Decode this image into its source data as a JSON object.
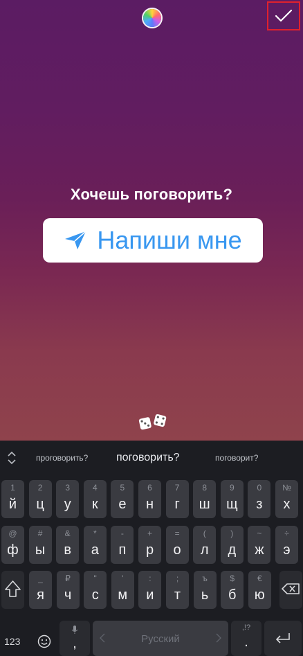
{
  "story": {
    "question": "Хочешь поговорить?",
    "sticker_label": "Напиши мне"
  },
  "icons": {
    "color_picker": "color-wheel-icon",
    "done": "checkmark-icon",
    "dice": "dice-icon",
    "sticker": "paper-plane-icon"
  },
  "keyboard": {
    "suggestions": [
      "проговорить?",
      "поговорить?",
      "поговорит?"
    ],
    "row1": [
      {
        "sec": "1",
        "pri": "й"
      },
      {
        "sec": "2",
        "pri": "ц"
      },
      {
        "sec": "3",
        "pri": "у"
      },
      {
        "sec": "4",
        "pri": "к"
      },
      {
        "sec": "5",
        "pri": "е"
      },
      {
        "sec": "6",
        "pri": "н"
      },
      {
        "sec": "7",
        "pri": "г"
      },
      {
        "sec": "8",
        "pri": "ш"
      },
      {
        "sec": "9",
        "pri": "щ"
      },
      {
        "sec": "0",
        "pri": "з"
      },
      {
        "sec": "№",
        "pri": "х"
      }
    ],
    "row2": [
      {
        "sec": "@",
        "pri": "ф"
      },
      {
        "sec": "#",
        "pri": "ы"
      },
      {
        "sec": "&",
        "pri": "в"
      },
      {
        "sec": "*",
        "pri": "а"
      },
      {
        "sec": "-",
        "pri": "п"
      },
      {
        "sec": "+",
        "pri": "р"
      },
      {
        "sec": "=",
        "pri": "о"
      },
      {
        "sec": "(",
        "pri": "л"
      },
      {
        "sec": ")",
        "pri": "д"
      },
      {
        "sec": "~",
        "pri": "ж"
      },
      {
        "sec": "÷",
        "pri": "э"
      }
    ],
    "row3": [
      {
        "sec": "_",
        "pri": "я"
      },
      {
        "sec": "₽",
        "pri": "ч"
      },
      {
        "sec": "\"",
        "pri": "с"
      },
      {
        "sec": "'",
        "pri": "м"
      },
      {
        "sec": ":",
        "pri": "и"
      },
      {
        "sec": ";",
        "pri": "т"
      },
      {
        "sec": "ъ",
        "pri": "ь"
      },
      {
        "sec": "$",
        "pri": "б"
      },
      {
        "sec": "€",
        "pri": "ю"
      }
    ],
    "num_label": "123",
    "space_label": "Русский",
    "punct_label": ",!?",
    "punct_main": "."
  },
  "colors": {
    "accent": "#3897f0",
    "done_highlight": "#e0212d"
  }
}
